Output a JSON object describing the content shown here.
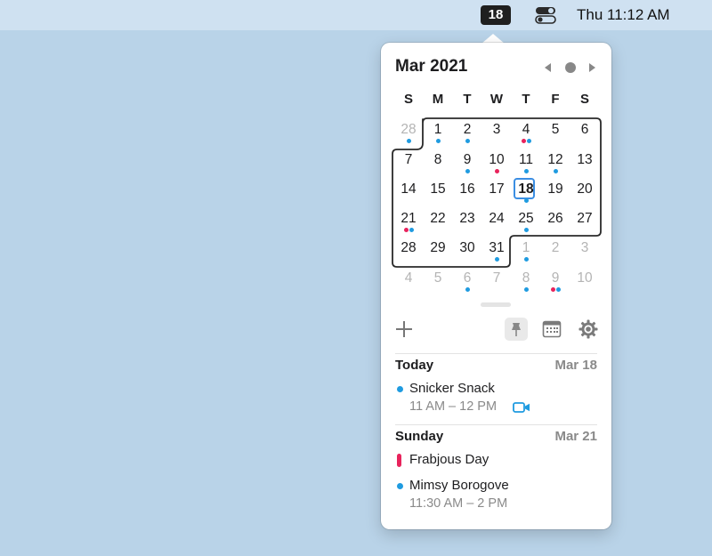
{
  "menubar": {
    "date_badge": "18",
    "clock": "Thu 11:12 AM",
    "control_center_icon": "toggle-switches-icon"
  },
  "calendar": {
    "title": "Mar 2021",
    "weekdays": [
      "S",
      "M",
      "T",
      "W",
      "T",
      "F",
      "S"
    ],
    "weeks": [
      [
        {
          "n": "28",
          "dim": true,
          "dots": [
            "blue"
          ]
        },
        {
          "n": "1",
          "dots": [
            "blue"
          ]
        },
        {
          "n": "2",
          "dots": [
            "blue"
          ]
        },
        {
          "n": "3",
          "dots": []
        },
        {
          "n": "4",
          "dots": [
            "red",
            "blue"
          ]
        },
        {
          "n": "5",
          "dots": []
        },
        {
          "n": "6",
          "dots": []
        }
      ],
      [
        {
          "n": "7",
          "dots": []
        },
        {
          "n": "8",
          "dots": []
        },
        {
          "n": "9",
          "dots": [
            "blue"
          ]
        },
        {
          "n": "10",
          "dots": [
            "red"
          ]
        },
        {
          "n": "11",
          "dots": [
            "blue"
          ]
        },
        {
          "n": "12",
          "dots": [
            "blue"
          ]
        },
        {
          "n": "13",
          "dots": []
        }
      ],
      [
        {
          "n": "14",
          "dots": []
        },
        {
          "n": "15",
          "dots": []
        },
        {
          "n": "16",
          "dots": []
        },
        {
          "n": "17",
          "dots": []
        },
        {
          "n": "18",
          "today": true,
          "dots": [
            "blue"
          ]
        },
        {
          "n": "19",
          "dots": []
        },
        {
          "n": "20",
          "dots": []
        }
      ],
      [
        {
          "n": "21",
          "dots": [
            "red",
            "blue"
          ]
        },
        {
          "n": "22",
          "dots": []
        },
        {
          "n": "23",
          "dots": []
        },
        {
          "n": "24",
          "dots": []
        },
        {
          "n": "25",
          "dots": [
            "blue"
          ]
        },
        {
          "n": "26",
          "dots": []
        },
        {
          "n": "27",
          "dots": []
        }
      ],
      [
        {
          "n": "28",
          "dots": []
        },
        {
          "n": "29",
          "dots": []
        },
        {
          "n": "30",
          "dots": []
        },
        {
          "n": "31",
          "dots": [
            "blue"
          ]
        },
        {
          "n": "1",
          "dim": true,
          "dots": [
            "blue"
          ]
        },
        {
          "n": "2",
          "dim": true,
          "dots": []
        },
        {
          "n": "3",
          "dim": true,
          "dots": []
        }
      ],
      [
        {
          "n": "4",
          "dim": true,
          "dots": []
        },
        {
          "n": "5",
          "dim": true,
          "dots": []
        },
        {
          "n": "6",
          "dim": true,
          "dots": [
            "blue"
          ]
        },
        {
          "n": "7",
          "dim": true,
          "dots": []
        },
        {
          "n": "8",
          "dim": true,
          "dots": [
            "blue"
          ]
        },
        {
          "n": "9",
          "dim": true,
          "dots": [
            "red",
            "blue"
          ]
        },
        {
          "n": "10",
          "dim": true,
          "dots": []
        }
      ]
    ]
  },
  "toolbar": {
    "add_icon": "plus-icon",
    "pin_icon": "pushpin-icon",
    "calendar_icon": "calendar-grid-icon",
    "settings_icon": "gear-icon"
  },
  "agenda": {
    "today": {
      "label": "Today",
      "date": "Mar 18",
      "events": [
        {
          "title": "Snicker Snack",
          "time": "11 AM – 12 PM",
          "color": "#1f9be0",
          "video": true
        }
      ]
    },
    "sunday": {
      "label": "Sunday",
      "date": "Mar 21",
      "events": [
        {
          "title": "Frabjous Day",
          "color": "#e8235c",
          "all_day": true
        },
        {
          "title": "Mimsy Borogove",
          "time": "11:30 AM – 2 PM",
          "color": "#1f9be0"
        }
      ]
    }
  },
  "colors": {
    "blue": "#1f9be0",
    "red": "#e8235c",
    "today_ring": "#3b8ee3"
  }
}
